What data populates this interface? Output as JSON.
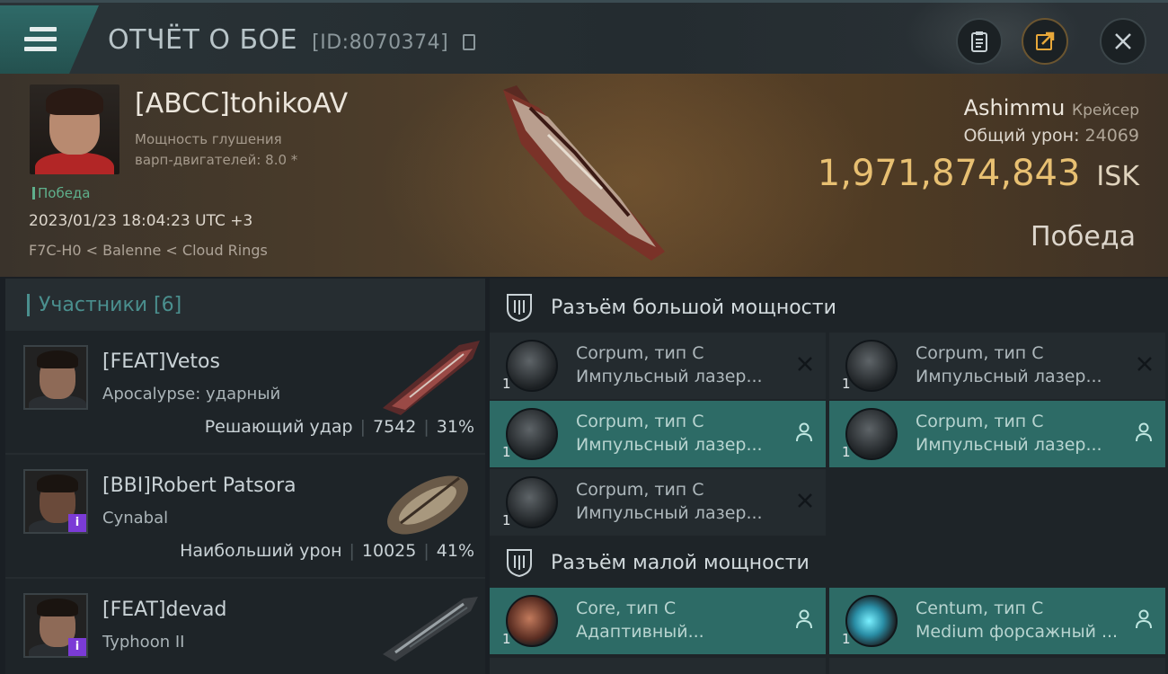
{
  "header": {
    "title": "ОТЧЁТ О БОЕ",
    "report_id": "[ID:8070374]"
  },
  "victim": {
    "name": "[ABCC]tohikoAV",
    "scram_line1": "Мощность глушения",
    "scram_line2": "варп-двигателей: 8.0 *",
    "status": "Победа",
    "datetime": "2023/01/23 18:04:23 UTC +3",
    "location": "F7C-H0 < Balenne < Cloud Rings",
    "ship": "Ashimmu",
    "ship_class": "Крейсер",
    "total_damage_label": "Общий урон:",
    "total_damage": "24069",
    "isk_value": "1,971,874,843",
    "isk_unit": "ISK",
    "result": "Победа"
  },
  "participants": {
    "header": "Участники [6]",
    "items": [
      {
        "name": "[FEAT]Vetos",
        "ship": "Apocalypse: ударный",
        "role": "Решающий удар",
        "damage": "7542",
        "percent": "31%",
        "badge": ""
      },
      {
        "name": "[BBI]Robert Patsora",
        "ship": "Cynabal",
        "role": "Наибольший урон",
        "damage": "10025",
        "percent": "41%",
        "badge": "i"
      },
      {
        "name": "[FEAT]devad",
        "ship": "Typhoon II",
        "role": "",
        "damage": "",
        "percent": "",
        "badge": "i"
      }
    ]
  },
  "fitting": {
    "high_slots_label": "Разъём большой мощности",
    "low_slots_label": "Разъём малой мощности",
    "high": [
      {
        "line1": "Corpum, тип C",
        "line2": "Импульсный лазер...",
        "qty": "1",
        "state": "destroyed"
      },
      {
        "line1": "Corpum, тип C",
        "line2": "Импульсный лазер...",
        "qty": "1",
        "state": "destroyed"
      },
      {
        "line1": "Corpum, тип C",
        "line2": "Импульсный лазер...",
        "qty": "1",
        "state": "dropped"
      },
      {
        "line1": "Corpum, тип C",
        "line2": "Импульсный лазер...",
        "qty": "1",
        "state": "dropped"
      },
      {
        "line1": "Corpum, тип C",
        "line2": "Импульсный лазер...",
        "qty": "1",
        "state": "destroyed"
      }
    ],
    "low": [
      {
        "line1": "Core, тип C",
        "line2": "Адаптивный...",
        "qty": "1",
        "state": "dropped"
      },
      {
        "line1": "Centum, тип C",
        "line2": "Medium форсажный ...",
        "qty": "1",
        "state": "dropped"
      }
    ]
  },
  "colors": {
    "accent": "#2d6b66",
    "isk": "#e8c072",
    "victory": "#5fb08c",
    "badge": "#7b3bd6"
  }
}
